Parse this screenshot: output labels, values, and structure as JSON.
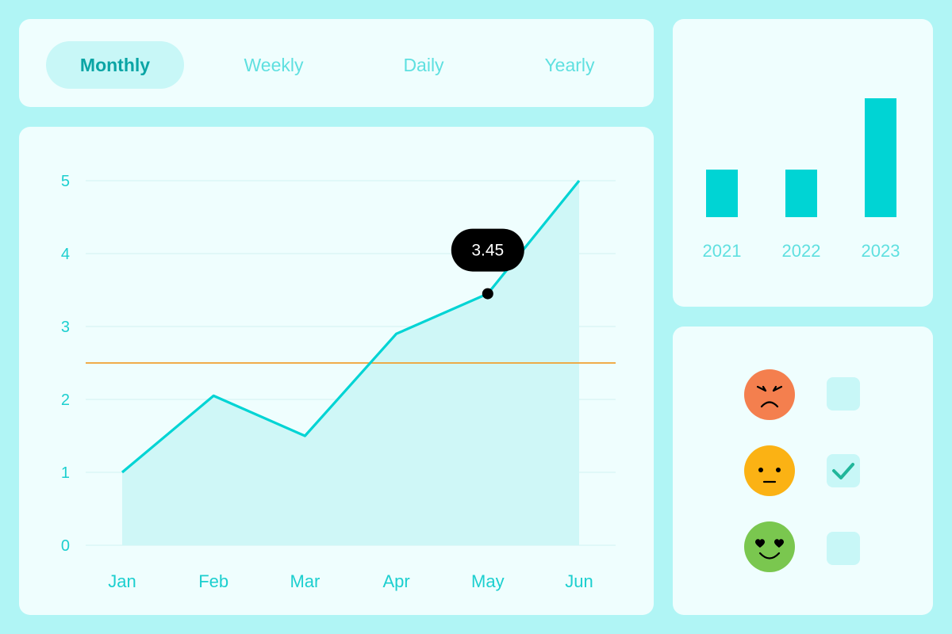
{
  "tabs": [
    {
      "label": "Monthly",
      "active": true
    },
    {
      "label": "Weekly",
      "active": false
    },
    {
      "label": "Daily",
      "active": false
    },
    {
      "label": "Yearly",
      "active": false
    }
  ],
  "colors": {
    "accent": "#00d4d4",
    "accent_fill": "#cff7f7",
    "threshold": "#f0a030",
    "tooltip_bg": "#000000",
    "tick_text": "#1ccfcf"
  },
  "chart_data": [
    {
      "type": "line",
      "categories": [
        "Jan",
        "Feb",
        "Mar",
        "Apr",
        "May",
        "Jun"
      ],
      "values": [
        1.0,
        2.05,
        1.5,
        2.9,
        3.45,
        5.0
      ],
      "ylim": [
        0,
        5
      ],
      "yticks": [
        0,
        1,
        2,
        3,
        4,
        5
      ],
      "threshold": 2.5,
      "area_fill": true,
      "grid": true,
      "tooltip": {
        "category": "May",
        "label": "3.45"
      }
    },
    {
      "type": "bar",
      "categories": [
        "2021",
        "2022",
        "2023"
      ],
      "values": [
        0.4,
        0.4,
        1.0
      ]
    }
  ],
  "mood": [
    {
      "icon": "angry-face-icon",
      "color": "#f47f4e",
      "checked": false
    },
    {
      "icon": "neutral-face-icon",
      "color": "#fbb214",
      "checked": true
    },
    {
      "icon": "heart-eyes-face-icon",
      "color": "#7ac74f",
      "checked": false
    }
  ]
}
